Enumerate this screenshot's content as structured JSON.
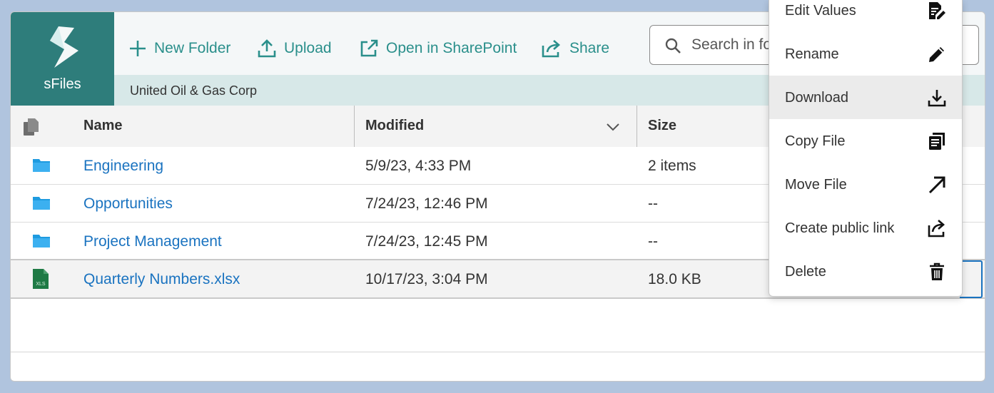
{
  "app": {
    "name": "sFiles"
  },
  "toolbar": {
    "new_folder": "New Folder",
    "upload": "Upload",
    "open_sharepoint": "Open in SharePoint",
    "share": "Share"
  },
  "search": {
    "placeholder": "Search in fo"
  },
  "breadcrumb": {
    "path": "United Oil & Gas Corp"
  },
  "columns": {
    "name": "Name",
    "modified": "Modified",
    "size": "Size"
  },
  "rows": [
    {
      "type": "folder-icon",
      "name": "Engineering",
      "modified": "5/9/23, 4:33 PM",
      "size": "2 items"
    },
    {
      "type": "folder-icon",
      "name": "Opportunities",
      "modified": "7/24/23, 12:46 PM",
      "size": "--"
    },
    {
      "type": "folder-icon",
      "name": "Project Management",
      "modified": "7/24/23, 12:45 PM",
      "size": "--"
    },
    {
      "type": "xls-file-icon",
      "icon_label": "XLS",
      "name": "Quarterly Numbers.xlsx",
      "modified": "10/17/23, 3:04 PM",
      "size": "18.0 KB"
    }
  ],
  "context_menu": {
    "items": [
      {
        "label": "Edit Values",
        "icon": "edit-values-icon"
      },
      {
        "label": "Rename",
        "icon": "pencil-icon"
      },
      {
        "label": "Download",
        "icon": "download-icon"
      },
      {
        "label": "Copy File",
        "icon": "copy-icon"
      },
      {
        "label": "Move File",
        "icon": "arrow-up-right-icon"
      },
      {
        "label": "Create public link",
        "icon": "share-link-icon"
      },
      {
        "label": "Delete",
        "icon": "trash-icon"
      }
    ]
  },
  "colors": {
    "brand": "#2e7d7b",
    "accent": "#2a8f8b",
    "link": "#1a73c0",
    "folder": "#1e9be0",
    "excel": "#1f7a45"
  }
}
